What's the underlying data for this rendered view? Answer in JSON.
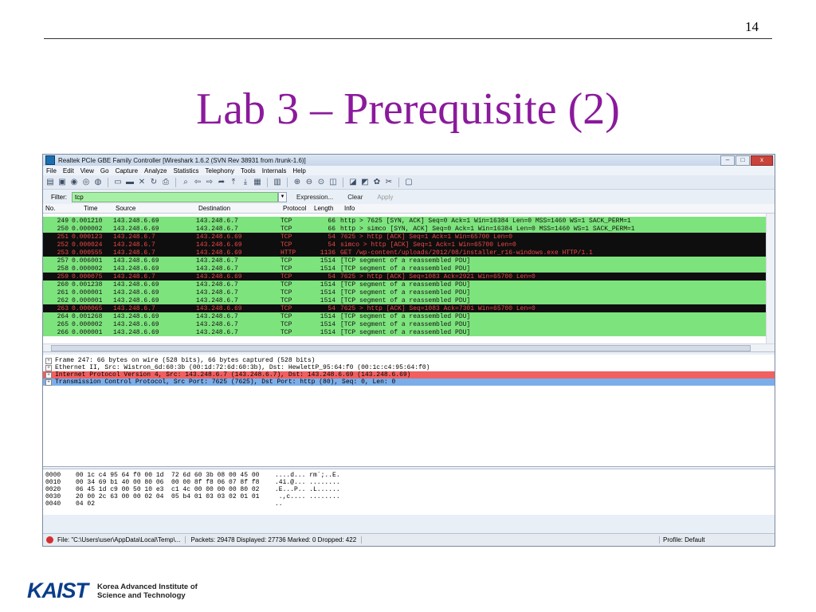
{
  "slide": {
    "number": "14",
    "title": "Lab 3 – Prerequisite (2)"
  },
  "window": {
    "title": "Realtek PCIe GBE Family Controller   [Wireshark 1.6.2  (SVN Rev 38931 from /trunk-1.6)]",
    "controls": [
      "–",
      "□",
      "x"
    ]
  },
  "menu": [
    "File",
    "Edit",
    "View",
    "Go",
    "Capture",
    "Analyze",
    "Statistics",
    "Telephony",
    "Tools",
    "Internals",
    "Help"
  ],
  "toolbar_icons": [
    "interfaces-icon",
    "options-icon",
    "start-icon",
    "stop-icon",
    "restart-icon",
    "open-icon",
    "save-icon",
    "close-file-icon",
    "reload-icon",
    "print-icon",
    "find-icon",
    "back-icon",
    "forward-icon",
    "goto-icon",
    "first-icon",
    "last-icon",
    "colorize-icon",
    "autoscroll-icon",
    "zoom-in-icon",
    "zoom-out-icon",
    "zoom-normal-icon",
    "resize-columns-icon",
    "capture-filters-icon",
    "display-filters-icon",
    "coloring-rules-icon",
    "preferences-icon",
    "help-icon"
  ],
  "filter": {
    "label": "Filter:",
    "value": "tcp",
    "expression": "Expression...",
    "clear": "Clear",
    "apply": "Apply"
  },
  "columns": {
    "no": "No.",
    "time": "Time",
    "source": "Source",
    "destination": "Destination",
    "protocol": "Protocol",
    "length": "Length",
    "info": "Info"
  },
  "packets": [
    {
      "no": "249",
      "time": "0.001210",
      "src": "143.248.6.69",
      "dst": "143.248.6.7",
      "proto": "TCP",
      "len": "66",
      "info": "http > 7625 [SYN, ACK] Seq=0 Ack=1 Win=16384 Len=0 MSS=1460 WS=1 SACK_PERM=1",
      "color": "green"
    },
    {
      "no": "250",
      "time": "0.000002",
      "src": "143.248.6.69",
      "dst": "143.248.6.7",
      "proto": "TCP",
      "len": "66",
      "info": "http > simco [SYN, ACK] Seq=0 Ack=1 Win=16384 Len=0 MSS=1460 WS=1 SACK_PERM=1",
      "color": "green"
    },
    {
      "no": "251",
      "time": "0.000123",
      "src": "143.248.6.7",
      "dst": "143.248.6.69",
      "proto": "TCP",
      "len": "54",
      "info": "7625 > http [ACK] Seq=1 Ack=1 Win=65700 Len=0",
      "color": "black"
    },
    {
      "no": "252",
      "time": "0.000024",
      "src": "143.248.6.7",
      "dst": "143.248.6.69",
      "proto": "TCP",
      "len": "54",
      "info": "simco > http [ACK] Seq=1 Ack=1 Win=65700 Len=0",
      "color": "black"
    },
    {
      "no": "253",
      "time": "0.000555",
      "src": "143.248.6.7",
      "dst": "143.248.6.69",
      "proto": "HTTP",
      "len": "1136",
      "info": "GET /wp-content/uploads/2012/08/installer_r16-windows.exe HTTP/1.1",
      "color": "black"
    },
    {
      "no": "257",
      "time": "0.006001",
      "src": "143.248.6.69",
      "dst": "143.248.6.7",
      "proto": "TCP",
      "len": "1514",
      "info": "[TCP segment of a reassembled PDU]",
      "color": "green"
    },
    {
      "no": "258",
      "time": "0.000002",
      "src": "143.248.6.69",
      "dst": "143.248.6.7",
      "proto": "TCP",
      "len": "1514",
      "info": "[TCP segment of a reassembled PDU]",
      "color": "green"
    },
    {
      "no": "259",
      "time": "0.000075",
      "src": "143.248.6.7",
      "dst": "143.248.6.69",
      "proto": "TCP",
      "len": "54",
      "info": "7625 > http [ACK] Seq=1083 Ack=2921 Win=65700 Len=0",
      "color": "black"
    },
    {
      "no": "260",
      "time": "0.001238",
      "src": "143.248.6.69",
      "dst": "143.248.6.7",
      "proto": "TCP",
      "len": "1514",
      "info": "[TCP segment of a reassembled PDU]",
      "color": "green"
    },
    {
      "no": "261",
      "time": "0.000001",
      "src": "143.248.6.69",
      "dst": "143.248.6.7",
      "proto": "TCP",
      "len": "1514",
      "info": "[TCP segment of a reassembled PDU]",
      "color": "green"
    },
    {
      "no": "262",
      "time": "0.000001",
      "src": "143.248.6.69",
      "dst": "143.248.6.7",
      "proto": "TCP",
      "len": "1514",
      "info": "[TCP segment of a reassembled PDU]",
      "color": "green"
    },
    {
      "no": "263",
      "time": "0.000065",
      "src": "143.248.6.7",
      "dst": "143.248.6.69",
      "proto": "TCP",
      "len": "54",
      "info": "7625 > http [ACK] Seq=1083 Ack=7301 Win=65700 Len=0",
      "color": "black"
    },
    {
      "no": "264",
      "time": "0.001268",
      "src": "143.248.6.69",
      "dst": "143.248.6.7",
      "proto": "TCP",
      "len": "1514",
      "info": "[TCP segment of a reassembled PDU]",
      "color": "green"
    },
    {
      "no": "265",
      "time": "0.000002",
      "src": "143.248.6.69",
      "dst": "143.248.6.7",
      "proto": "TCP",
      "len": "1514",
      "info": "[TCP segment of a reassembled PDU]",
      "color": "green"
    },
    {
      "no": "266",
      "time": "0.000001",
      "src": "143.248.6.69",
      "dst": "143.248.6.7",
      "proto": "TCP",
      "len": "1514",
      "info": "[TCP segment of a reassembled PDU]",
      "color": "green"
    }
  ],
  "details": [
    {
      "text": "Frame 247: 66 bytes on wire (528 bits), 66 bytes captured (528 bits)",
      "color": "white"
    },
    {
      "text": "Ethernet II, Src: Wistron_6d:60:3b (00:1d:72:6d:60:3b), Dst: HewlettP_95:64:f0 (00:1c:c4:95:64:f0)",
      "color": "white"
    },
    {
      "text": "Internet Protocol Version 4, Src: 143.248.6.7 (143.248.6.7), Dst: 143.248.6.69 (143.248.6.69)",
      "color": "red"
    },
    {
      "text": "Transmission Control Protocol, Src Port: 7625 (7625), Dst Port: http (80), Seq: 0, Len: 0",
      "color": "blue"
    }
  ],
  "hex": [
    {
      "off": "0000",
      "bytes": "00 1c c4 95 64 f0 00 1d  72 6d 60 3b 08 00 45 00",
      "ascii": "....d... rm`;..E."
    },
    {
      "off": "0010",
      "bytes": "00 34 69 b1 40 00 80 06  00 00 8f f8 06 07 8f f8",
      "ascii": ".4i.@... ........"
    },
    {
      "off": "0020",
      "bytes": "06 45 1d c9 00 50 10 e3  c1 4c 00 00 00 00 80 02",
      "ascii": ".E...P.. .L......"
    },
    {
      "off": "0030",
      "bytes": "20 00 2c 63 00 00 02 04  05 b4 01 03 03 02 01 01",
      "ascii": " .,c.... ........"
    },
    {
      "off": "0040",
      "bytes": "04 02",
      "ascii": ".."
    }
  ],
  "status": {
    "file": "File: \"C:\\Users\\user\\AppData\\Local\\Temp\\...",
    "packets": "Packets: 29478 Displayed: 27736 Marked: 0 Dropped: 422",
    "profile": "Profile: Default"
  },
  "logo": {
    "mark": "KAIST",
    "line1": "Korea Advanced Institute of",
    "line2": "Science and Technology"
  },
  "colors": {
    "title": "#8b1a9c",
    "green_row": "#7de37d",
    "black_row": "#0e0e0e",
    "black_row_text": "#f04848",
    "filter_ok": "#a6f0a6"
  }
}
